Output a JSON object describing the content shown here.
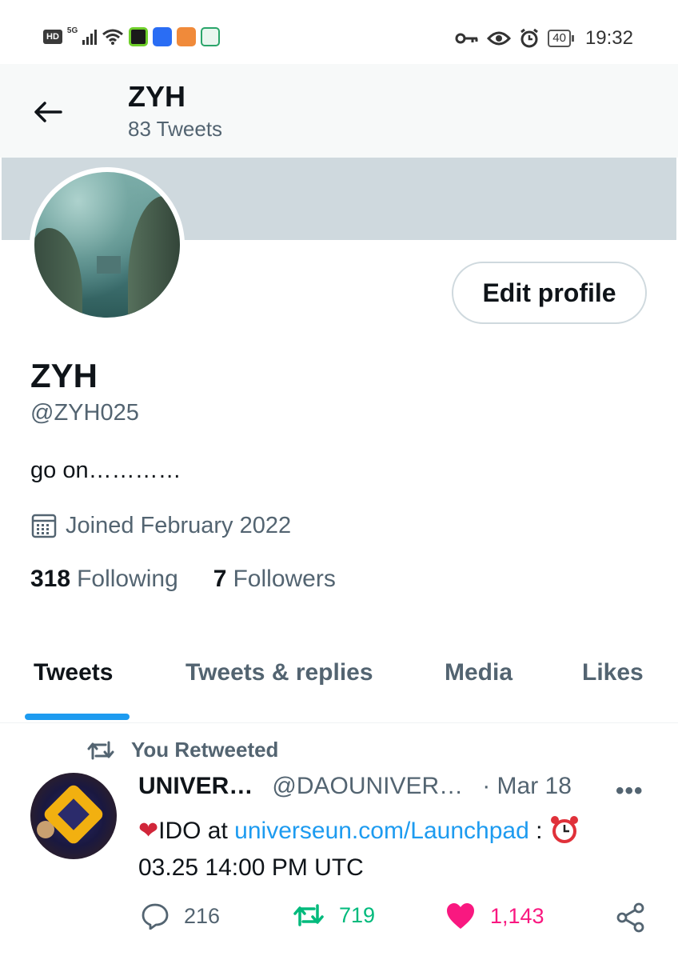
{
  "status_bar": {
    "hd": "HD",
    "network": "5G",
    "battery": "40",
    "time": "19:32"
  },
  "header": {
    "title": "ZYH",
    "tweet_count": "83 Tweets"
  },
  "profile": {
    "edit_button": "Edit profile",
    "name": "ZYH",
    "handle": "@ZYH025",
    "bio": "go on…………",
    "joined": "Joined February 2022",
    "following_count": "318",
    "following_label": "Following",
    "followers_count": "7",
    "followers_label": "Followers"
  },
  "tabs": [
    {
      "label": "Tweets",
      "active": true
    },
    {
      "label": "Tweets & replies",
      "active": false
    },
    {
      "label": "Media",
      "active": false
    },
    {
      "label": "Likes",
      "active": false
    }
  ],
  "tweet": {
    "retweeted_label": "You Retweeted",
    "author": "UNIVER…",
    "handle": "@DAOUNIVER…",
    "date": "· Mar 18",
    "more": "•••",
    "body_prefix": "IDO at ",
    "link": "universeun.com/Launchpad",
    "body_suffix": " : ",
    "body_line2": "03.25 14:00 PM UTC",
    "replies": "216",
    "retweets": "719",
    "likes": "1,143"
  },
  "colors": {
    "accent": "#1d9bf0",
    "retweet_green": "#00ba7c",
    "like_pink": "#f91880",
    "muted": "#536471",
    "banner": "#cfd9de"
  }
}
